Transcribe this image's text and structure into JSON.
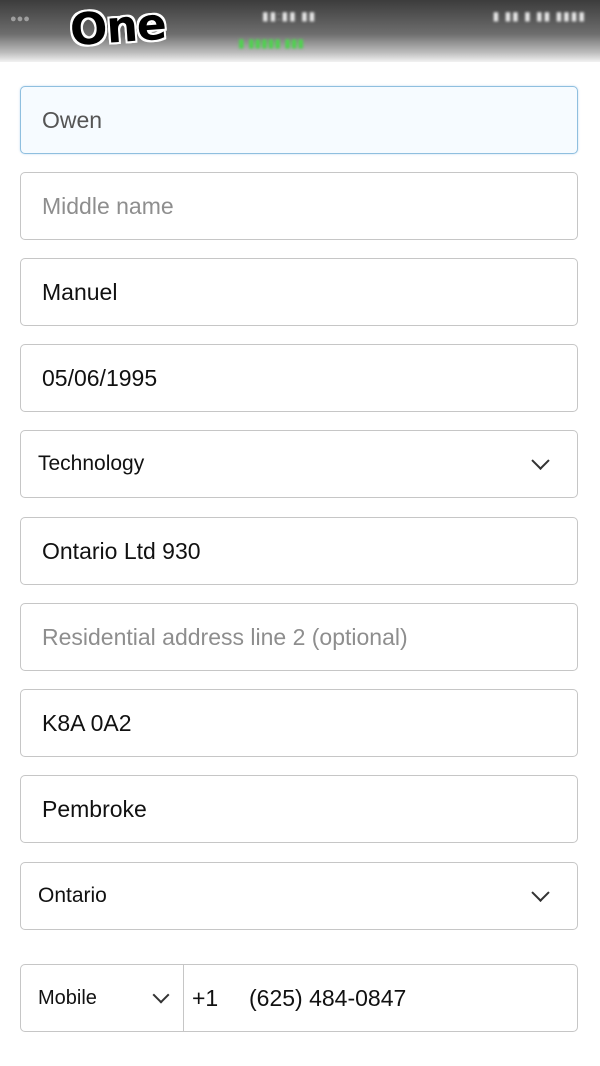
{
  "header": {
    "logo_text": "One"
  },
  "form": {
    "first_name": {
      "value": "Owen"
    },
    "middle_name": {
      "placeholder": "Middle name"
    },
    "last_name": {
      "value": "Manuel"
    },
    "date_of_birth": {
      "value": "05/06/1995"
    },
    "industry": {
      "selected": "Technology"
    },
    "address_line_1": {
      "value": "Ontario Ltd 930"
    },
    "address_line_2": {
      "placeholder": "Residential address line 2 (optional)"
    },
    "postal_code": {
      "value": "K8A 0A2"
    },
    "city": {
      "value": "Pembroke"
    },
    "province": {
      "selected": "Ontario"
    },
    "phone": {
      "type_selected": "Mobile",
      "country_code": "+1",
      "number": "(625) 484-0847"
    }
  },
  "icons": {
    "dropdown": "chevron-down-icon"
  },
  "colors": {
    "field_border": "#c6c6c6",
    "focus_border": "#8fbfdf",
    "placeholder": "#8e8e8e"
  }
}
